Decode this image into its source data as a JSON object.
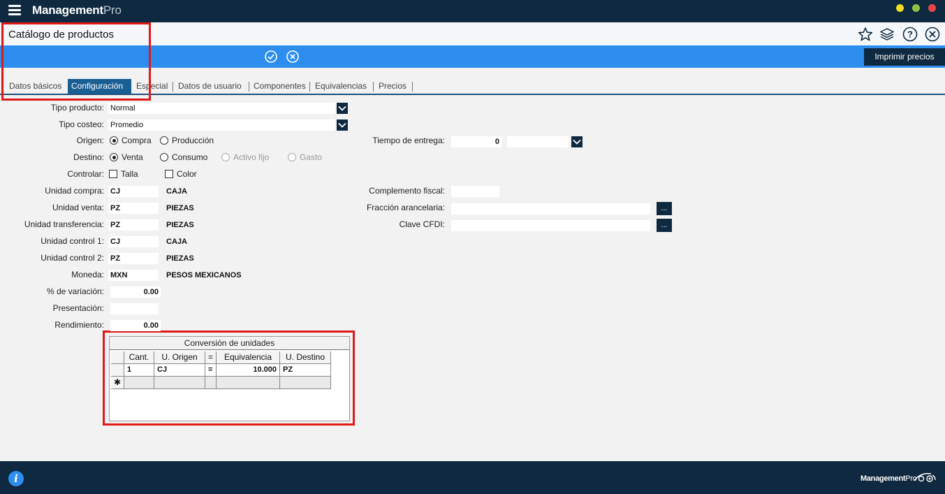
{
  "app": {
    "brand_bold": "Management",
    "brand_light": "Pro"
  },
  "window_controls": {
    "minimize_color": "#f0e020",
    "maximize_color": "#8cc63e",
    "close_color": "#e8454a"
  },
  "header": {
    "title": "Catálogo de productos"
  },
  "toolbar": {
    "print_label": "Imprimir precios"
  },
  "tabs": [
    {
      "label": "Datos básicos"
    },
    {
      "label": "Configuración",
      "active": true
    },
    {
      "label": "Especial"
    },
    {
      "label": "Datos de usuario"
    },
    {
      "label": "Componentes"
    },
    {
      "label": "Equivalencias"
    },
    {
      "label": "Precios"
    }
  ],
  "form": {
    "tipo_producto": {
      "label": "Tipo producto:",
      "value": "Normal"
    },
    "tipo_costeo": {
      "label": "Tipo costeo:",
      "value": "Promedio"
    },
    "origen": {
      "label": "Origen:",
      "options": [
        "Compra",
        "Producción"
      ],
      "selected": "Compra"
    },
    "destino": {
      "label": "Destino:",
      "options": [
        "Venta",
        "Consumo",
        "Activo fijo",
        "Gasto"
      ],
      "selected": "Venta"
    },
    "controlar": {
      "label": "Controlar:",
      "options": [
        "Talla",
        "Color"
      ]
    },
    "unidad_compra": {
      "label": "Unidad compra:",
      "code": "CJ",
      "desc": "CAJA"
    },
    "unidad_venta": {
      "label": "Unidad venta:",
      "code": "PZ",
      "desc": "PIEZAS"
    },
    "unidad_transferencia": {
      "label": "Unidad transferencia:",
      "code": "PZ",
      "desc": "PIEZAS"
    },
    "unidad_control1": {
      "label": "Unidad control 1:",
      "code": "CJ",
      "desc": "CAJA"
    },
    "unidad_control2": {
      "label": "Unidad control 2:",
      "code": "PZ",
      "desc": "PIEZAS"
    },
    "moneda": {
      "label": "Moneda:",
      "code": "MXN",
      "desc": "PESOS MEXICANOS"
    },
    "variacion": {
      "label": "% de variación:",
      "value": "0.00"
    },
    "presentacion": {
      "label": "Presentación:",
      "value": ""
    },
    "rendimiento": {
      "label": "Rendimiento:",
      "value": "0.00"
    },
    "tiempo_entrega": {
      "label": "Tiempo de entrega:",
      "value": "0",
      "unit": ""
    },
    "complemento_fiscal": {
      "label": "Complemento fiscal:",
      "value": ""
    },
    "fraccion_arancelaria": {
      "label": "Fracción arancelaria:",
      "value": "",
      "button": "..."
    },
    "clave_cfdi": {
      "label": "Clave CFDI:",
      "value": "",
      "button": "..."
    }
  },
  "conversion": {
    "title": "Conversión de unidades",
    "headers": [
      "Cant.",
      "U. Origen",
      "=",
      "Equivalencia",
      "U. Destino"
    ],
    "rows": [
      {
        "cant": "1",
        "origen": "CJ",
        "eq": "=",
        "equivalencia": "10.000",
        "destino": "PZ"
      }
    ],
    "new_row_marker": "✱"
  },
  "footer": {
    "brand_bold": "Management",
    "brand_light": "Pro",
    "info_glyph": "i"
  }
}
